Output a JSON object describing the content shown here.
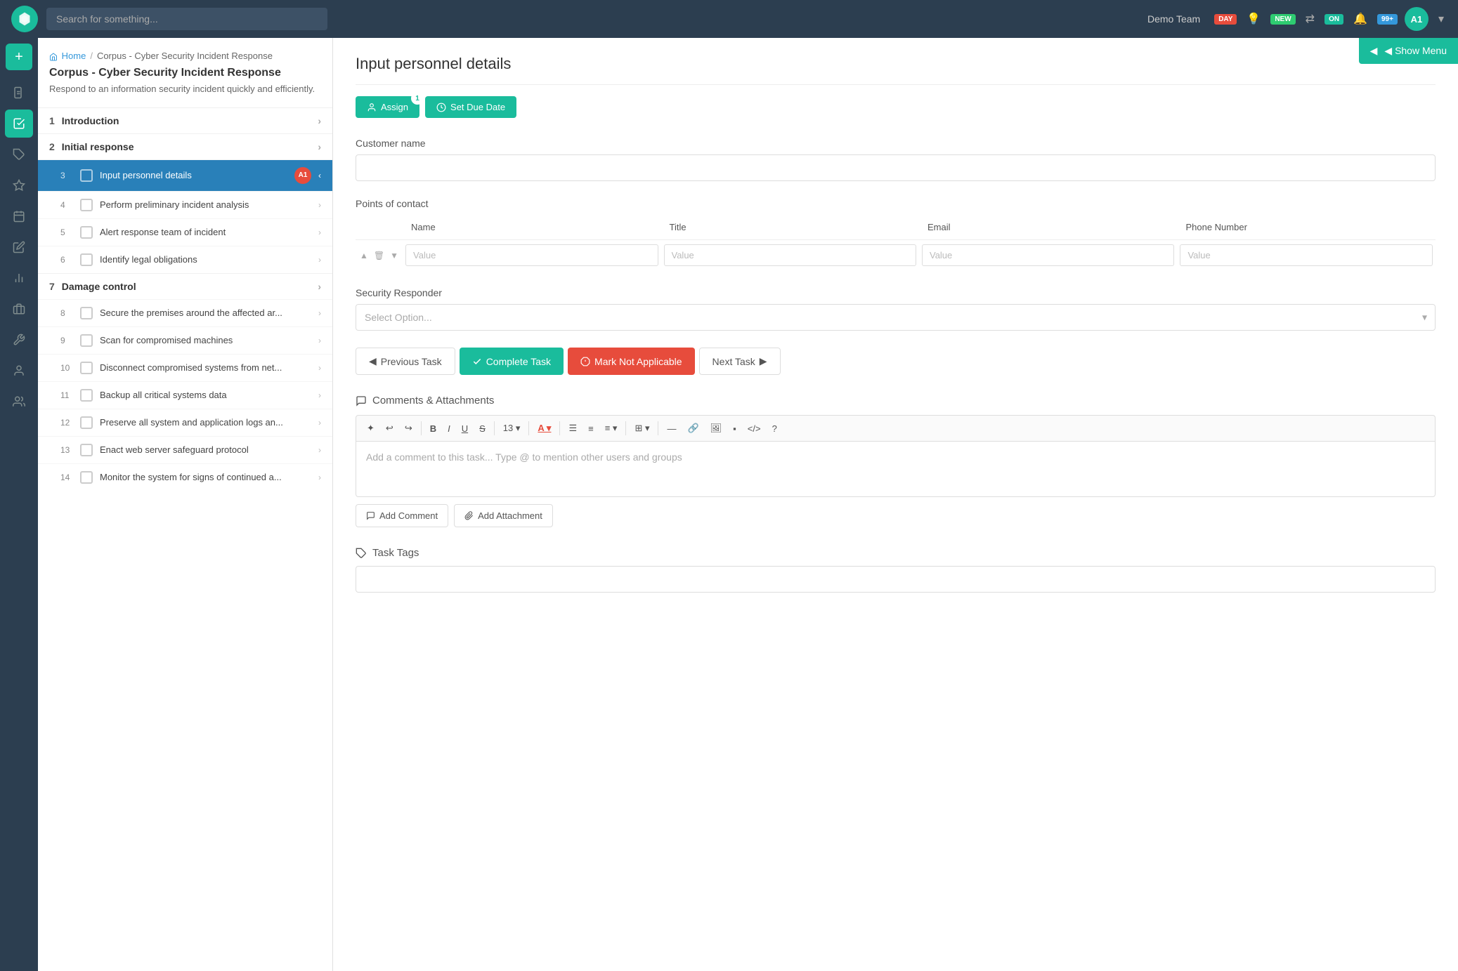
{
  "app": {
    "logo_text": "✦",
    "search_placeholder": "Search for something..."
  },
  "top_nav": {
    "team_name": "Demo Team",
    "badge_day": "DAY",
    "badge_new": "NEW",
    "badge_on": "ON",
    "badge_99": "99+",
    "avatar": "A1"
  },
  "show_menu_btn": "◀ Show Menu",
  "breadcrumb": {
    "home": "Home",
    "separator": "/",
    "current": "Corpus - Cyber Security Incident Response"
  },
  "panel": {
    "title": "Corpus - Cyber Security Incident Response",
    "description": "Respond to an information security incident quickly and efficiently."
  },
  "tasks": [
    {
      "num": "1",
      "label": "Introduction",
      "type": "section"
    },
    {
      "num": "2",
      "label": "Initial response",
      "type": "section"
    },
    {
      "num": "3",
      "label": "Input personnel details",
      "type": "item",
      "active": true,
      "avatar": "A1"
    },
    {
      "num": "4",
      "label": "Perform preliminary incident analysis",
      "type": "item"
    },
    {
      "num": "5",
      "label": "Alert response team of incident",
      "type": "item"
    },
    {
      "num": "6",
      "label": "Identify legal obligations",
      "type": "item"
    },
    {
      "num": "7",
      "label": "Damage control",
      "type": "section"
    },
    {
      "num": "8",
      "label": "Secure the premises around the affected ar...",
      "type": "item"
    },
    {
      "num": "9",
      "label": "Scan for compromised machines",
      "type": "item"
    },
    {
      "num": "10",
      "label": "Disconnect compromised systems from net...",
      "type": "item"
    },
    {
      "num": "11",
      "label": "Backup all critical systems data",
      "type": "item"
    },
    {
      "num": "12",
      "label": "Preserve all system and application logs an...",
      "type": "item"
    },
    {
      "num": "13",
      "label": "Enact web server safeguard protocol",
      "type": "item"
    },
    {
      "num": "14",
      "label": "Monitor the system for signs of continued a...",
      "type": "item"
    }
  ],
  "main": {
    "title": "Input personnel details",
    "assign_btn": "Assign",
    "assign_badge": "1",
    "due_date_btn": "Set Due Date",
    "customer_name_label": "Customer name",
    "customer_name_placeholder": "",
    "points_of_contact_label": "Points of contact",
    "table_headers": [
      "Name",
      "Title",
      "Email",
      "Phone Number"
    ],
    "table_row_placeholder": "Value",
    "security_responder_label": "Security Responder",
    "security_responder_placeholder": "Select Option...",
    "prev_task_btn": "◀ Previous Task",
    "complete_task_btn": "✓ Complete Task",
    "not_applicable_btn": "⚑ Mark Not Applicable",
    "next_task_btn": "Next Task ▶",
    "comments_title": "Comments & Attachments",
    "editor_placeholder": "Add a comment to this task... Type @ to mention other users and groups",
    "add_comment_btn": "Add Comment",
    "add_attachment_btn": "Add Attachment",
    "task_tags_title": "Task Tags",
    "toolbar_buttons": [
      "✦",
      "↩",
      "↪",
      "B",
      "I",
      "U",
      "S",
      "13",
      "A",
      "≡",
      "≡",
      "≡",
      "⊞",
      "—",
      "🔗",
      "🖼",
      "▪",
      "</>",
      "?"
    ]
  }
}
